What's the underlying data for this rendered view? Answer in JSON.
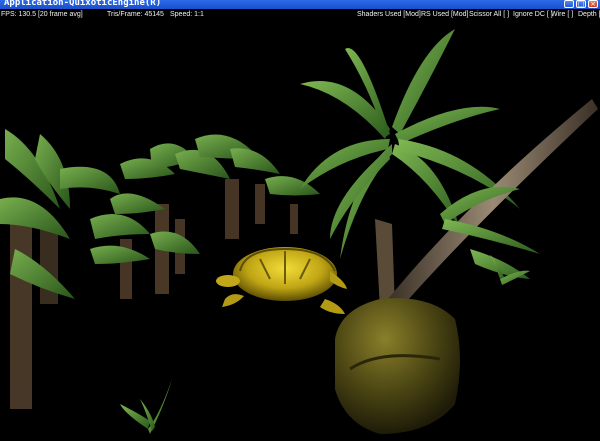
{
  "window": {
    "title": "Application-QuixoticEngine(R)",
    "min_icon": "minimize-icon",
    "max_icon": "maximize-icon",
    "close_icon": "close-icon"
  },
  "hud": {
    "fps": "FPS: 130.5 [20 frame avg]",
    "tris": "Tris/Frame:   45145",
    "speed": "Speed:  1:1",
    "shaders": "Shaders Used [Mod]",
    "rs": "RS Used [Mod]",
    "scissor": "Scissor All [ ]",
    "ignore_dc": "Ignore DC [ ]",
    "wire": "Wire [ ]",
    "depth": "Depth ["
  },
  "colors": {
    "title_bar": "#1a4fc9",
    "background": "#000000",
    "foliage": "#3f7a2a",
    "turtle": "#c9b21a",
    "rock": "#5a5418"
  }
}
